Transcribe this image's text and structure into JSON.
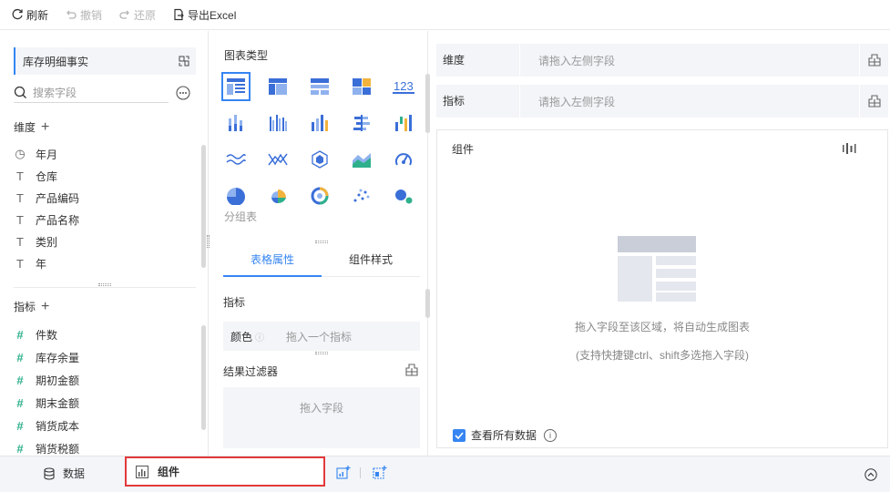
{
  "toolbar": {
    "refresh": "刷新",
    "undo": "撤销",
    "redo": "还原",
    "export": "导出Excel"
  },
  "left_panel": {
    "dataset": "库存明细事实",
    "search_placeholder": "搜索字段",
    "dimensions_title": "维度",
    "dimensions": [
      {
        "icon": "clock-icon",
        "label": "年月"
      },
      {
        "icon": "text-field-icon",
        "label": "仓库"
      },
      {
        "icon": "text-field-icon",
        "label": "产品编码"
      },
      {
        "icon": "text-field-icon",
        "label": "产品名称"
      },
      {
        "icon": "text-field-icon",
        "label": "类别"
      },
      {
        "icon": "text-field-icon",
        "label": "年"
      }
    ],
    "measures_title": "指标",
    "measures": [
      {
        "icon": "hash-icon",
        "label": "件数"
      },
      {
        "icon": "hash-icon",
        "label": "库存余量"
      },
      {
        "icon": "hash-icon",
        "label": "期初金额"
      },
      {
        "icon": "hash-icon",
        "label": "期末金额"
      },
      {
        "icon": "hash-icon",
        "label": "销货成本"
      },
      {
        "icon": "hash-icon",
        "label": "销货税额"
      }
    ]
  },
  "mid_panel": {
    "chart_types_title": "图表类型",
    "selected_type_label": "分组表",
    "chart_type_icons": [
      "group-table-icon",
      "cross-table-icon",
      "detail-table-icon",
      "treemap-block-icon",
      "kpi-number-icon",
      "stacked-column-icon",
      "grouped-column-icon",
      "multi-column-icon",
      "bar-compare-icon",
      "waterfall-icon",
      "wave-line-icon",
      "scatter-line-icon",
      "radar-hex-icon",
      "area-chart-icon",
      "gauge-icon",
      "pie-icon",
      "rose-pie-icon",
      "ring-pie-icon",
      "dot-scatter-icon",
      "bubble-icon"
    ],
    "tabs": [
      "表格属性",
      "组件样式"
    ],
    "measure_label": "指标",
    "color_label": "颜色",
    "color_placeholder": "拖入一个指标",
    "result_filter_label": "结果过滤器",
    "filter_placeholder": "拖入字段"
  },
  "right_panel": {
    "dimension_label": "维度",
    "dimension_placeholder": "请拖入左侧字段",
    "measure_label": "指标",
    "measure_placeholder": "请拖入左侧字段",
    "component_title": "组件",
    "empty_hint": "拖入字段至该区域，将自动生成图表",
    "empty_hint_sub": "(支持快捷键ctrl、shift多选拖入字段)",
    "view_all_data": "查看所有数据",
    "view_all_checked": true
  },
  "bottom_bar": {
    "data_tab": "数据",
    "component_tab": "组件"
  },
  "colors": {
    "accent": "#3685f2",
    "highlight_border": "#e2393b",
    "measure_icon": "#2fb08c"
  }
}
